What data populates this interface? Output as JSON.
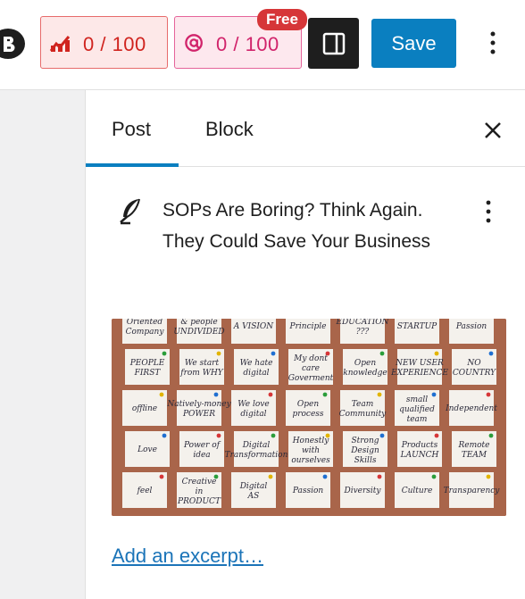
{
  "toolbar": {
    "brand_icon": "b-logo-icon",
    "seo_score": {
      "value": "0 / 100",
      "icon": "bar-chart-icon",
      "color": "#d0241f"
    },
    "content_score": {
      "value": "0 / 100",
      "icon": "at-ai-icon",
      "badge": "Free",
      "color": "#d1246b"
    },
    "sidebar_toggle_icon": "sidebar-layout-icon",
    "save_label": "Save",
    "more_icon": "vertical-ellipsis-icon",
    "accent": "#0a7fc0"
  },
  "sidebar": {
    "tabs": [
      {
        "label": "Post",
        "active": true
      },
      {
        "label": "Block",
        "active": false
      }
    ],
    "close_icon": "close-icon",
    "post": {
      "icon": "quill-icon",
      "title": "SOPs Are Boring? Think Again. They Could Save Your Business",
      "more_icon": "vertical-ellipsis-icon"
    },
    "featured_image": {
      "notes": [
        [
          "Oriented Company",
          "& people UNDIVIDED",
          "A VISION",
          "Principle",
          "EDUCATION ???",
          "STARTUP",
          "Passion"
        ],
        [
          "PEOPLE FIRST",
          "We start from WHY",
          "We hate digital",
          "My dont care Goverment",
          "Open knowledge",
          "NEW USER EXPERIENCE",
          "NO COUNTRY"
        ],
        [
          "offline",
          "Natively-money POWER",
          "We love digital",
          "Open process",
          "Team Community",
          "small qualified team",
          "Independent"
        ],
        [
          "Love",
          "Power of idea",
          "Digital Transformation",
          "Honestly with ourselves",
          "Strong Design Skills",
          "Products LAUNCH",
          "Remote TEAM"
        ],
        [
          "feel",
          "Creative in PRODUCT",
          "Digital AS",
          "Passion",
          "Diversity",
          "Culture",
          "Transparency"
        ]
      ]
    },
    "excerpt_link": "Add an excerpt…"
  }
}
